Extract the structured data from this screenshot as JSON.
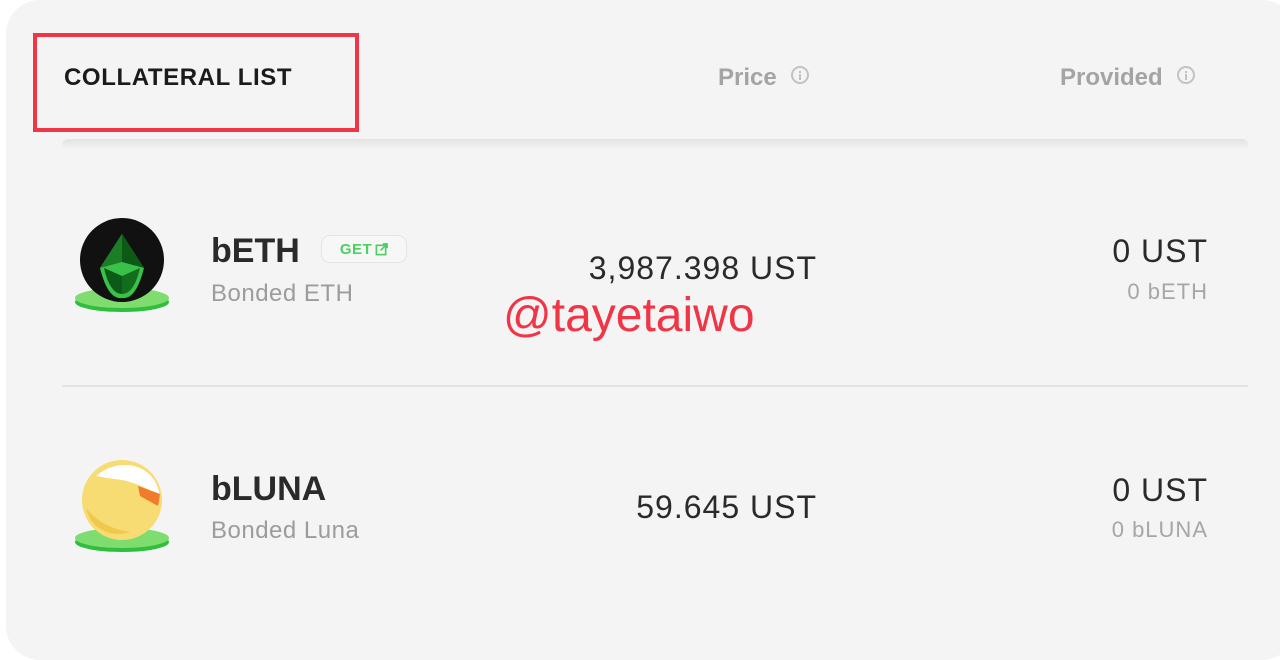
{
  "header": {
    "title": "COLLATERAL LIST",
    "columns": {
      "price": "Price",
      "provided": "Provided"
    }
  },
  "collaterals": [
    {
      "symbol": "bETH",
      "name": "Bonded ETH",
      "get_label": "GET",
      "price": "3,987.398 UST",
      "provided_ust": "0 UST",
      "provided_token": "0 bETH",
      "icon": "ethereum-icon"
    },
    {
      "symbol": "bLUNA",
      "name": "Bonded Luna",
      "price": "59.645 UST",
      "provided_ust": "0 UST",
      "provided_token": "0 bLUNA",
      "icon": "luna-icon"
    }
  ],
  "watermark": "@tayetaiwo",
  "colors": {
    "highlight": "#ef3546",
    "get_badge": "#4bd161",
    "card_background": "#f4f4f4"
  }
}
